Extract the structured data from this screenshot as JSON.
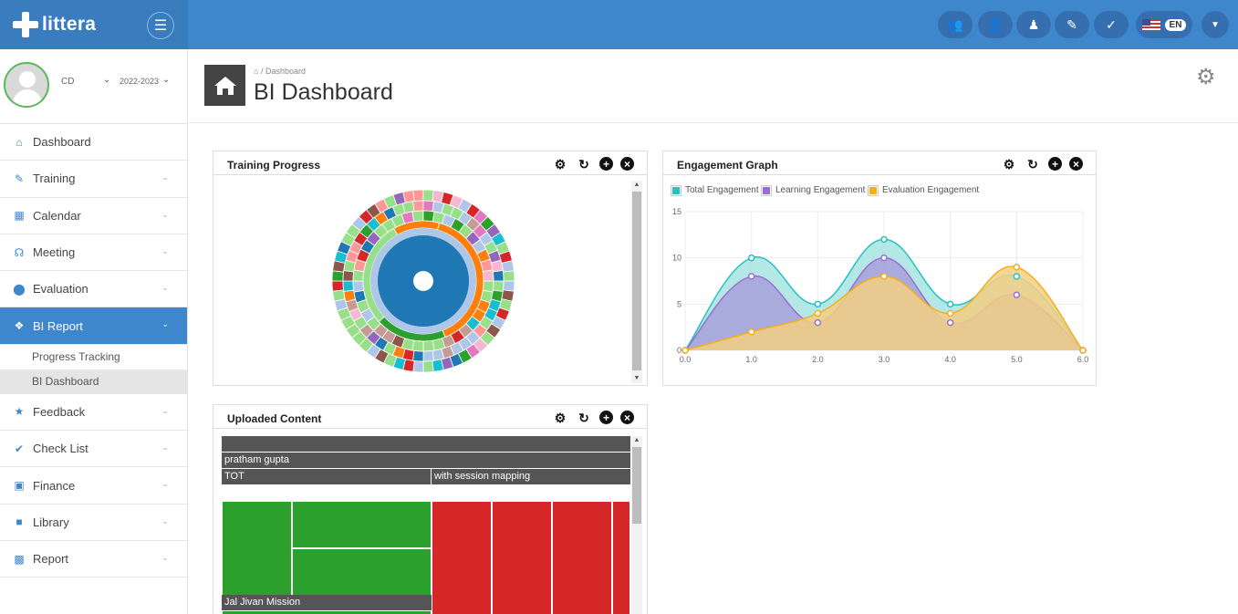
{
  "app": {
    "name": "littera"
  },
  "topbar": {
    "menu_icon": "hamburger-icon",
    "icons": [
      "users-icon",
      "user-icon",
      "person-icon",
      "edit-icon",
      "check-icon"
    ],
    "language": "EN"
  },
  "profile": {
    "user": "CD",
    "year": "2022-2023"
  },
  "sidebar": {
    "items": [
      {
        "label": "Dashboard",
        "icon": "home-icon"
      },
      {
        "label": "Training",
        "icon": "edit-icon"
      },
      {
        "label": "Calendar",
        "icon": "calendar-icon"
      },
      {
        "label": "Meeting",
        "icon": "headset-icon"
      },
      {
        "label": "Evaluation",
        "icon": "circle-icon"
      },
      {
        "label": "BI Report",
        "icon": "bi-report-icon"
      },
      {
        "label": "Feedback",
        "icon": "star-icon"
      },
      {
        "label": "Check List",
        "icon": "checklist-icon"
      },
      {
        "label": "Finance",
        "icon": "money-icon"
      },
      {
        "label": "Library",
        "icon": "folder-icon"
      },
      {
        "label": "Report",
        "icon": "report-icon"
      }
    ],
    "subitems": [
      {
        "label": "Progress Tracking"
      },
      {
        "label": "BI Dashboard"
      }
    ]
  },
  "header": {
    "breadcrumb": "Dashboard",
    "title": "BI Dashboard"
  },
  "panels": {
    "training": {
      "title": "Training Progress"
    },
    "engagement": {
      "title": "Engagement Graph"
    },
    "uploaded": {
      "title": "Uploaded Content",
      "labels": {
        "owner": "pratham gupta",
        "tot": "TOT",
        "mapping": "with session mapping",
        "mission": "Jal Jivan Mission"
      }
    }
  },
  "chart_data": {
    "type": "area",
    "title": "Engagement Graph",
    "x": [
      0,
      1,
      2,
      3,
      4,
      5,
      6
    ],
    "x_ticks": [
      "0.0",
      "1.0",
      "2.0",
      "3.0",
      "4.0",
      "5.0",
      "6.0"
    ],
    "y_ticks": [
      "0",
      "5",
      "10",
      "15"
    ],
    "ylim": [
      0,
      15
    ],
    "xlim": [
      0,
      6
    ],
    "grid": true,
    "legend_position": "top-left",
    "series": [
      {
        "name": "Total Engagement",
        "values": [
          0,
          10,
          5,
          12,
          5,
          8,
          0
        ],
        "color": "#27c1c1",
        "fill": "#a7e4e2"
      },
      {
        "name": "Learning Engagement",
        "values": [
          0,
          8,
          3,
          10,
          3,
          6,
          0
        ],
        "color": "#9b6fd1",
        "fill": "#a6a0d8"
      },
      {
        "name": "Evaluation Engagement",
        "values": [
          0,
          2,
          4,
          8,
          4,
          9,
          0
        ],
        "color": "#f5ae1f",
        "fill": "#f3cf83"
      }
    ]
  }
}
